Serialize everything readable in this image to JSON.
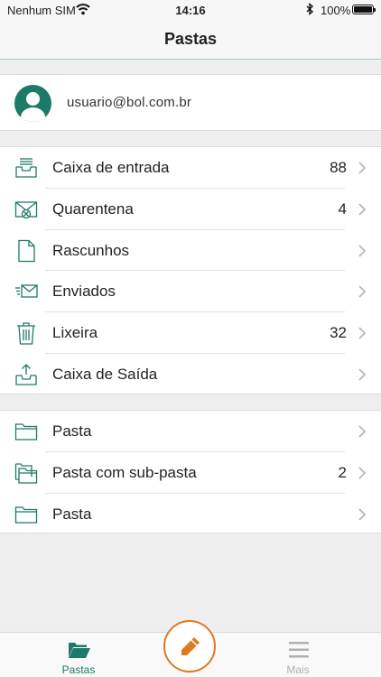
{
  "status_bar": {
    "carrier": "Nenhum SIM",
    "time": "14:16",
    "battery": "100%"
  },
  "header": {
    "title": "Pastas"
  },
  "account": {
    "email": "usuario@bol.com.br"
  },
  "folders": [
    {
      "label": "Caixa de entrada",
      "count": "88",
      "icon": "inbox-icon"
    },
    {
      "label": "Quarentena",
      "count": "4",
      "icon": "quarantine-icon"
    },
    {
      "label": "Rascunhos",
      "count": "",
      "icon": "draft-icon"
    },
    {
      "label": "Enviados",
      "count": "",
      "icon": "sent-icon"
    },
    {
      "label": "Lixeira",
      "count": "32",
      "icon": "trash-icon"
    },
    {
      "label": "Caixa de Saída",
      "count": "",
      "icon": "outbox-icon"
    }
  ],
  "custom_folders": [
    {
      "label": "Pasta",
      "count": "",
      "icon": "folder-icon"
    },
    {
      "label": "Pasta com sub-pasta",
      "count": "2",
      "icon": "subfolder-icon"
    },
    {
      "label": "Pasta",
      "count": "",
      "icon": "folder-icon"
    }
  ],
  "tab_bar": {
    "folders_label": "Pastas",
    "more_label": "Mais"
  },
  "colors": {
    "accent": "#1c7a68",
    "compose": "#e07a1f",
    "inactive": "#b0b0b0"
  }
}
